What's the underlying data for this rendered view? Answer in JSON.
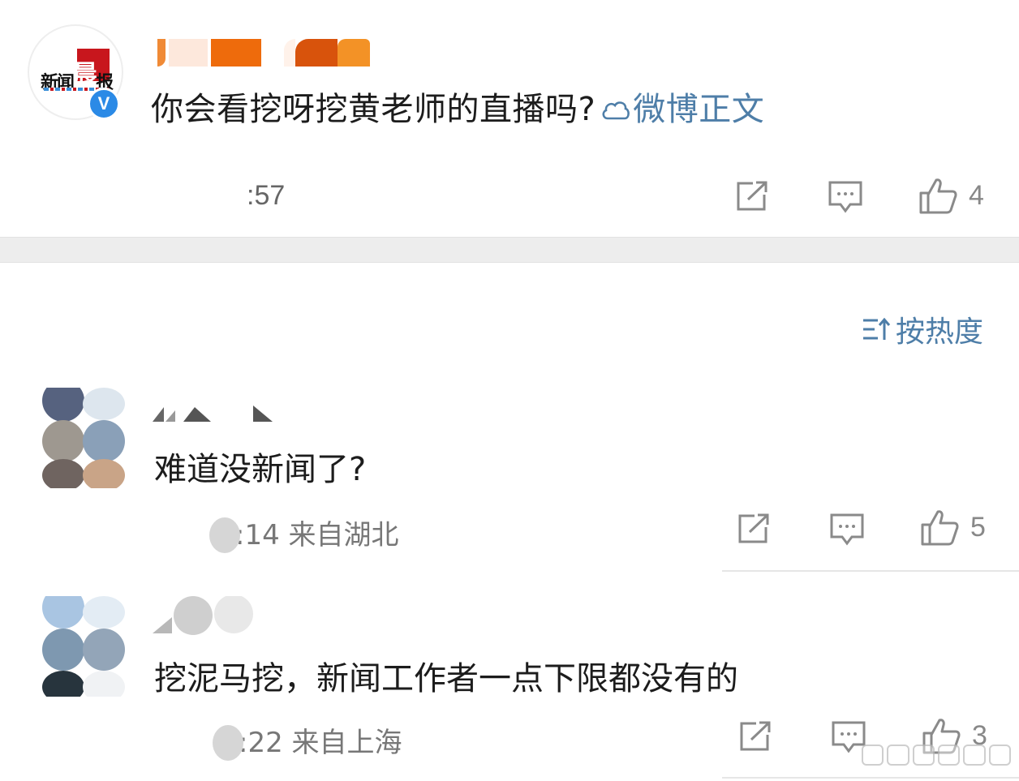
{
  "post": {
    "avatar_logo_text": "新闻晨报",
    "verified_badge": "V",
    "text": "你会看挖呀挖黄老师的直播吗?",
    "link_label": "微博正文",
    "time": ":57",
    "actions": {
      "share_icon": "share-icon",
      "comment_icon": "comment-icon",
      "like_icon": "thumbs-up-icon",
      "like_count": "4"
    }
  },
  "sort": {
    "label": "按热度",
    "icon": "sort-icon"
  },
  "comments": [
    {
      "text": "难道没新闻了?",
      "meta": ":14 来自湖北",
      "like_count": "5"
    },
    {
      "text": "挖泥马挖，新闻工作者一点下限都没有的",
      "meta": ":22 来自上海",
      "like_count": "3"
    }
  ],
  "colors": {
    "link_blue": "#4e7ea8",
    "meta_gray": "#888888",
    "band_gray": "#ededed",
    "brand_red": "#c8161d"
  }
}
